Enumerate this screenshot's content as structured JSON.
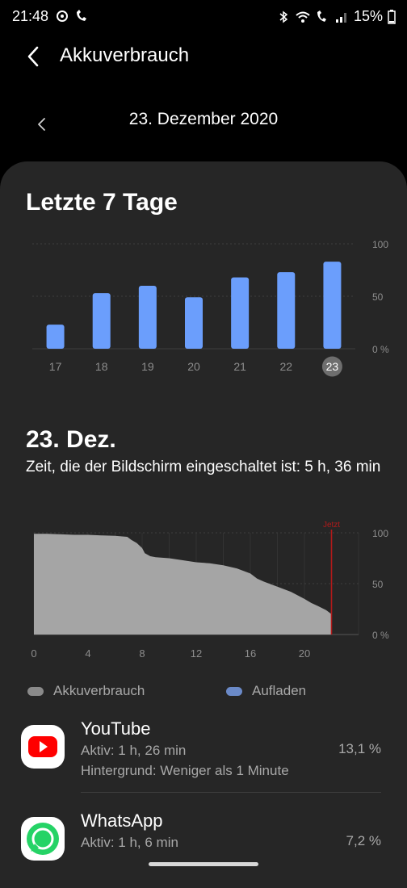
{
  "status_bar": {
    "time": "21:48",
    "battery": "15%"
  },
  "header": {
    "title": "Akkuverbrauch"
  },
  "date_nav": {
    "date": "23. Dezember 2020"
  },
  "weekly": {
    "title": "Letzte 7 Tage"
  },
  "daily": {
    "title": "23. Dez.",
    "screen_time": "Zeit, die der Bildschirm eingeschaltet ist: 5 h, 36 min"
  },
  "legend": {
    "usage": "Akkuverbrauch",
    "charging": "Aufladen"
  },
  "apps": [
    {
      "name": "YouTube",
      "active": "Aktiv: 1 h, 26 min",
      "background": "Hintergrund: Weniger als 1 Minute",
      "percent": "13,1 %"
    },
    {
      "name": "WhatsApp",
      "active": "Aktiv: 1 h, 6 min",
      "percent": "7,2 %"
    }
  ],
  "colors": {
    "bar": "#6b9efc",
    "area": "#a5a5a5",
    "now_line": "#b11a1a",
    "background": "#000000",
    "card": "#262626"
  },
  "chart_data": [
    {
      "type": "bar",
      "categories": [
        "17",
        "18",
        "19",
        "20",
        "21",
        "22",
        "23"
      ],
      "values": [
        23,
        53,
        60,
        49,
        68,
        73,
        83
      ],
      "selected": "23",
      "ylim": [
        0,
        100
      ],
      "yticks": [
        "0 %",
        "50",
        "100"
      ]
    },
    {
      "type": "area",
      "x": [
        0,
        1,
        2,
        3,
        4,
        5,
        6,
        6.9,
        7.2,
        7.6,
        8,
        8.2,
        8.6,
        9,
        10,
        11,
        12,
        13,
        14,
        15,
        15.6,
        16,
        16.5,
        17,
        18,
        19,
        20,
        20.5,
        21,
        21.6,
        22
      ],
      "y": [
        99,
        99,
        98.5,
        98,
        98,
        97.5,
        97,
        96,
        93,
        90,
        85,
        80,
        77,
        76,
        75,
        73,
        71,
        70,
        68,
        65,
        62,
        60,
        55,
        52,
        47,
        42,
        35,
        31,
        28,
        24,
        20
      ],
      "now_label": "Jetzt",
      "now_x": 22,
      "xticks": [
        "0",
        "4",
        "8",
        "12",
        "16",
        "20"
      ],
      "yticks": [
        "0 %",
        "50",
        "100"
      ],
      "xlim": [
        0,
        24
      ],
      "ylim": [
        0,
        100
      ]
    }
  ]
}
